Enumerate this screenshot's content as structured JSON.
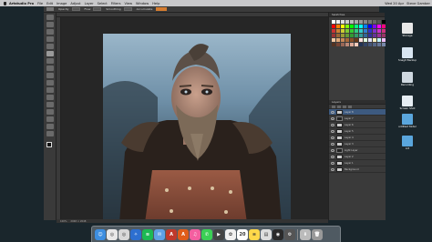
{
  "menubar": {
    "app_name": "Artstudio Pro",
    "items": [
      "File",
      "Edit",
      "Image",
      "Adjust",
      "Layer",
      "Select",
      "Filters",
      "View",
      "Window",
      "Help"
    ],
    "clock": "Wed 20 Apr",
    "user": "Steve Gamber"
  },
  "options": {
    "labels": [
      "Opacity",
      "Flow",
      "Smoothing",
      "Accumulate"
    ]
  },
  "status": {
    "left": "100%",
    "right": "2048 × 2048"
  },
  "panels": {
    "swatches_tab": "Swatches",
    "layers_tab": "Layers",
    "swatch_colors": [
      "#ffffff",
      "#eeeeee",
      "#dddddd",
      "#cccccc",
      "#bbbbbb",
      "#aaaaaa",
      "#999999",
      "#888888",
      "#777777",
      "#666666",
      "#555555",
      "#000000",
      "#ff0000",
      "#ff8000",
      "#ffff00",
      "#80ff00",
      "#00ff00",
      "#00ff80",
      "#00ffff",
      "#0080ff",
      "#0000ff",
      "#8000ff",
      "#ff00ff",
      "#ff0080",
      "#cc3333",
      "#cc8033",
      "#cccc33",
      "#80cc33",
      "#33cc33",
      "#33cc80",
      "#33cccc",
      "#3380cc",
      "#3333cc",
      "#8033cc",
      "#cc33cc",
      "#cc3380",
      "#993333",
      "#996633",
      "#999933",
      "#669933",
      "#339933",
      "#339966",
      "#339999",
      "#336699",
      "#333399",
      "#663399",
      "#993399",
      "#993366",
      "#f2c6a0",
      "#e0a878",
      "#c88858",
      "#a86838",
      "#885028",
      "#683818",
      "#ffe0e0",
      "#e0ffe0",
      "#e0e0ff",
      "#fff0c0",
      "#c0f0ff",
      "#f0c0ff",
      "#553322",
      "#774433",
      "#996655",
      "#bb8877",
      "#ddaa99",
      "#ffccbb",
      "#223355",
      "#334466",
      "#445577",
      "#556688",
      "#667799",
      "#7788aa"
    ],
    "layers": [
      {
        "name": "Layer 8",
        "dark": false
      },
      {
        "name": "Layer 7",
        "dark": true
      },
      {
        "name": "Layer 6",
        "dark": false
      },
      {
        "name": "Layer 5",
        "dark": false
      },
      {
        "name": "Layer 4",
        "dark": false
      },
      {
        "name": "Layer 3",
        "dark": false
      },
      {
        "name": "Light Layer",
        "dark": true
      },
      {
        "name": "Layer 2",
        "dark": false
      },
      {
        "name": "Layer 1",
        "dark": false
      },
      {
        "name": "Background",
        "dark": false
      }
    ]
  },
  "desktop": {
    "icons": [
      {
        "label": "Storage",
        "color": "#e8e8e8"
      },
      {
        "label": "Snagit Backup",
        "color": "#d9e6f2"
      },
      {
        "label": "Recording",
        "color": "#cfd8e0"
      },
      {
        "label": "Screen Shot",
        "color": "#e6edf3"
      },
      {
        "label": "untitled folder",
        "color": "#5aa6dd"
      },
      {
        "label": "Art",
        "color": "#5aa6dd"
      }
    ]
  },
  "dock": {
    "apps": [
      {
        "name": "finder",
        "color": "#3d8ee0",
        "glyph": "☺"
      },
      {
        "name": "chrome",
        "color": "#e8e8e8",
        "glyph": "◎"
      },
      {
        "name": "chrome-alt",
        "color": "#d8d8d8",
        "glyph": "◎"
      },
      {
        "name": "safari",
        "color": "#2d6fd0",
        "glyph": "✧"
      },
      {
        "name": "spotify",
        "color": "#1db954",
        "glyph": "≋"
      },
      {
        "name": "mail",
        "color": "#5ea1e6",
        "glyph": "✉"
      },
      {
        "name": "acrobat",
        "color": "#c0392b",
        "glyph": "A"
      },
      {
        "name": "illustrator",
        "color": "#e05c1a",
        "glyph": "A"
      },
      {
        "name": "itunes",
        "color": "#f45fa0",
        "glyph": "♫"
      },
      {
        "name": "messages",
        "color": "#3bd055",
        "glyph": "✆"
      },
      {
        "name": "movie",
        "color": "#444444",
        "glyph": "▶"
      },
      {
        "name": "photos",
        "color": "#f0f0f0",
        "glyph": "✿"
      },
      {
        "name": "calendar",
        "color": "#ffffff",
        "glyph": "20"
      },
      {
        "name": "notes",
        "color": "#ffd84a",
        "glyph": "≡"
      },
      {
        "name": "preview",
        "color": "#dddddd",
        "glyph": "▤"
      },
      {
        "name": "obs",
        "color": "#2a2a2a",
        "glyph": "◉"
      },
      {
        "name": "system",
        "color": "#555555",
        "glyph": "⚙"
      },
      {
        "name": "downloads",
        "color": "#bbbbbb",
        "glyph": "⬇"
      },
      {
        "name": "trash",
        "color": "#999999",
        "glyph": "🗑"
      }
    ]
  }
}
